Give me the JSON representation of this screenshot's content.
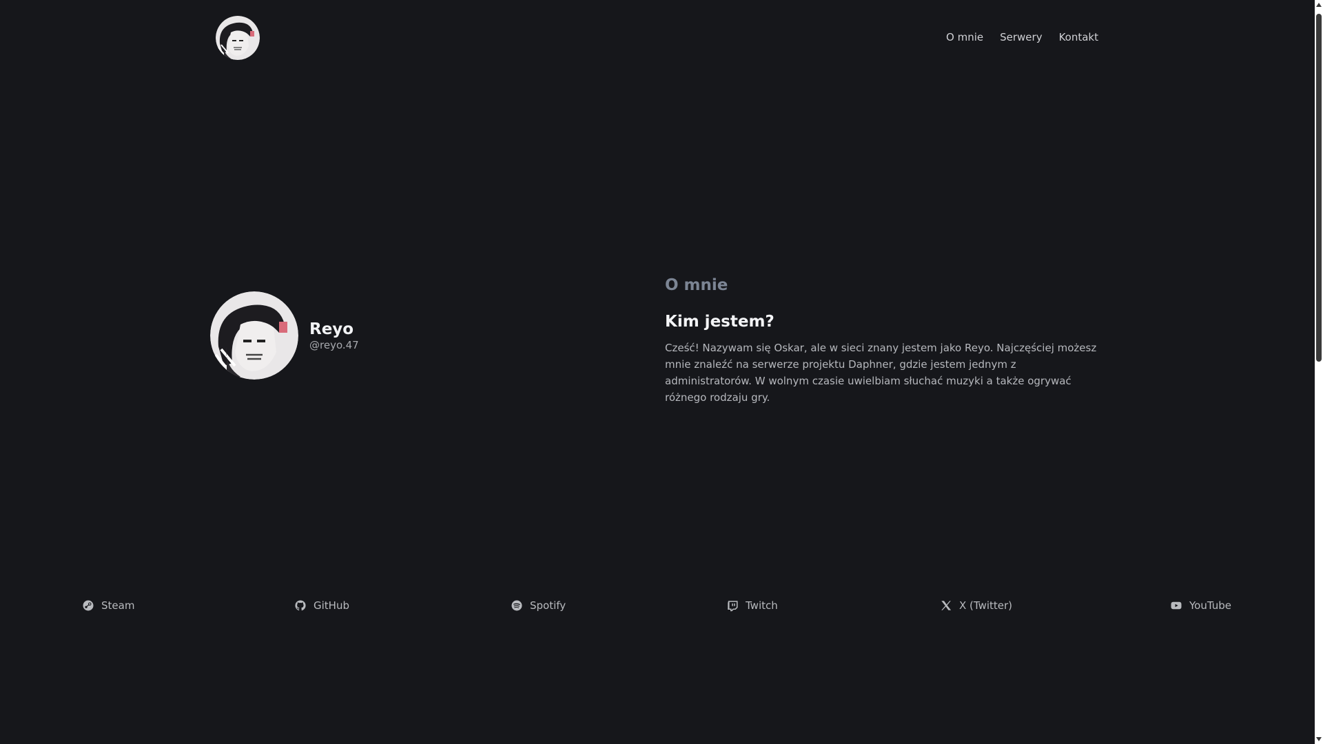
{
  "nav": {
    "items": [
      {
        "label": "O mnie"
      },
      {
        "label": "Serwery"
      },
      {
        "label": "Kontakt"
      }
    ]
  },
  "profile": {
    "name": "Reyo",
    "handle": "@reyo.47"
  },
  "about": {
    "section_label": "O mnie",
    "title": "Kim jestem?",
    "text": "Cześć! Nazywam się Oskar, ale w sieci znany jestem jako Reyo. Najczęściej możesz mnie znaleźć na serwerze projektu Daphner, gdzie jestem jednym z administratorów. W wolnym czasie uwielbiam słuchać muzyki a także ogrywać różnego rodzaju gry."
  },
  "socials": [
    {
      "label": "Steam",
      "icon": "steam-icon"
    },
    {
      "label": "GitHub",
      "icon": "github-icon"
    },
    {
      "label": "Spotify",
      "icon": "spotify-icon"
    },
    {
      "label": "Twitch",
      "icon": "twitch-icon"
    },
    {
      "label": "X (Twitter)",
      "icon": "x-icon"
    },
    {
      "label": "YouTube",
      "icon": "youtube-icon"
    }
  ],
  "colors": {
    "background": "#16171b",
    "accent_muted": "#7c8594",
    "text": "#b6b8bd"
  }
}
